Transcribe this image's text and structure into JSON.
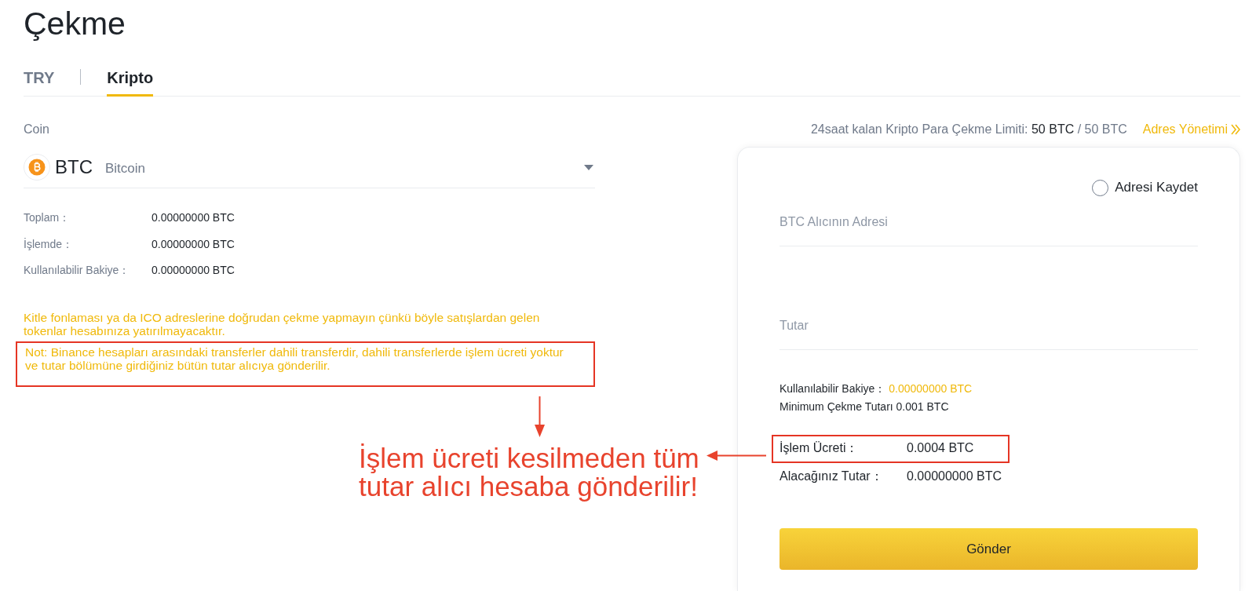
{
  "page": {
    "title": "Çekme"
  },
  "tabs": [
    {
      "label": "TRY",
      "selected": false
    },
    {
      "label": "Kripto",
      "selected": true
    }
  ],
  "coin": {
    "label": "Coin",
    "symbol": "BTC",
    "name": "Bitcoin"
  },
  "balances": [
    {
      "label": "Toplam：",
      "value": "0.00000000 BTC"
    },
    {
      "label": "İşlemde：",
      "value": "0.00000000 BTC"
    },
    {
      "label": "Kullanılabilir Bakiye：",
      "value": "0.00000000 BTC"
    }
  ],
  "notices": [
    {
      "text": "Kitle fonlaması ya da ICO adreslerine doğrudan çekme yapmayın çünkü böyle satışlardan gelen tokenlar hesabınıza yatırılmayacaktır.",
      "highlighted": false
    },
    {
      "text": "Not: Binance hesapları arasındaki transferler dahili transferdir, dahili transferlerde işlem ücreti yoktur ve tutar bölümüne girdiğiniz bütün tutar alıcıya gönderilir.",
      "highlighted": true
    }
  ],
  "limit": {
    "label": "24saat kalan Kripto Para Çekme Limiti:",
    "remaining": "50 BTC",
    "separator": "/",
    "total": "50 BTC"
  },
  "address_management": {
    "label": "Adres Yönetimi"
  },
  "form": {
    "save_address": {
      "label": "Adresi Kaydet",
      "checked": false
    },
    "fields": [
      {
        "placeholder": "BTC Alıcının Adresi"
      },
      {
        "placeholder": "Tutar"
      }
    ],
    "available_balance": {
      "label": "Kullanılabilir Bakiye：",
      "value": "0.00000000 BTC"
    },
    "minimum": "Minimum Çekme Tutarı 0.001 BTC",
    "summary": [
      {
        "label": "İşlem Ücreti：",
        "value": "0.0004 BTC",
        "highlighted": true
      },
      {
        "label": "Alacağınız Tutar：",
        "value": "0.00000000 BTC",
        "highlighted": false
      }
    ],
    "submit": "Gönder"
  },
  "annotation": {
    "text": "İşlem ücreti kesilmeden tüm tutar alıcı hesaba gönderilir!"
  }
}
